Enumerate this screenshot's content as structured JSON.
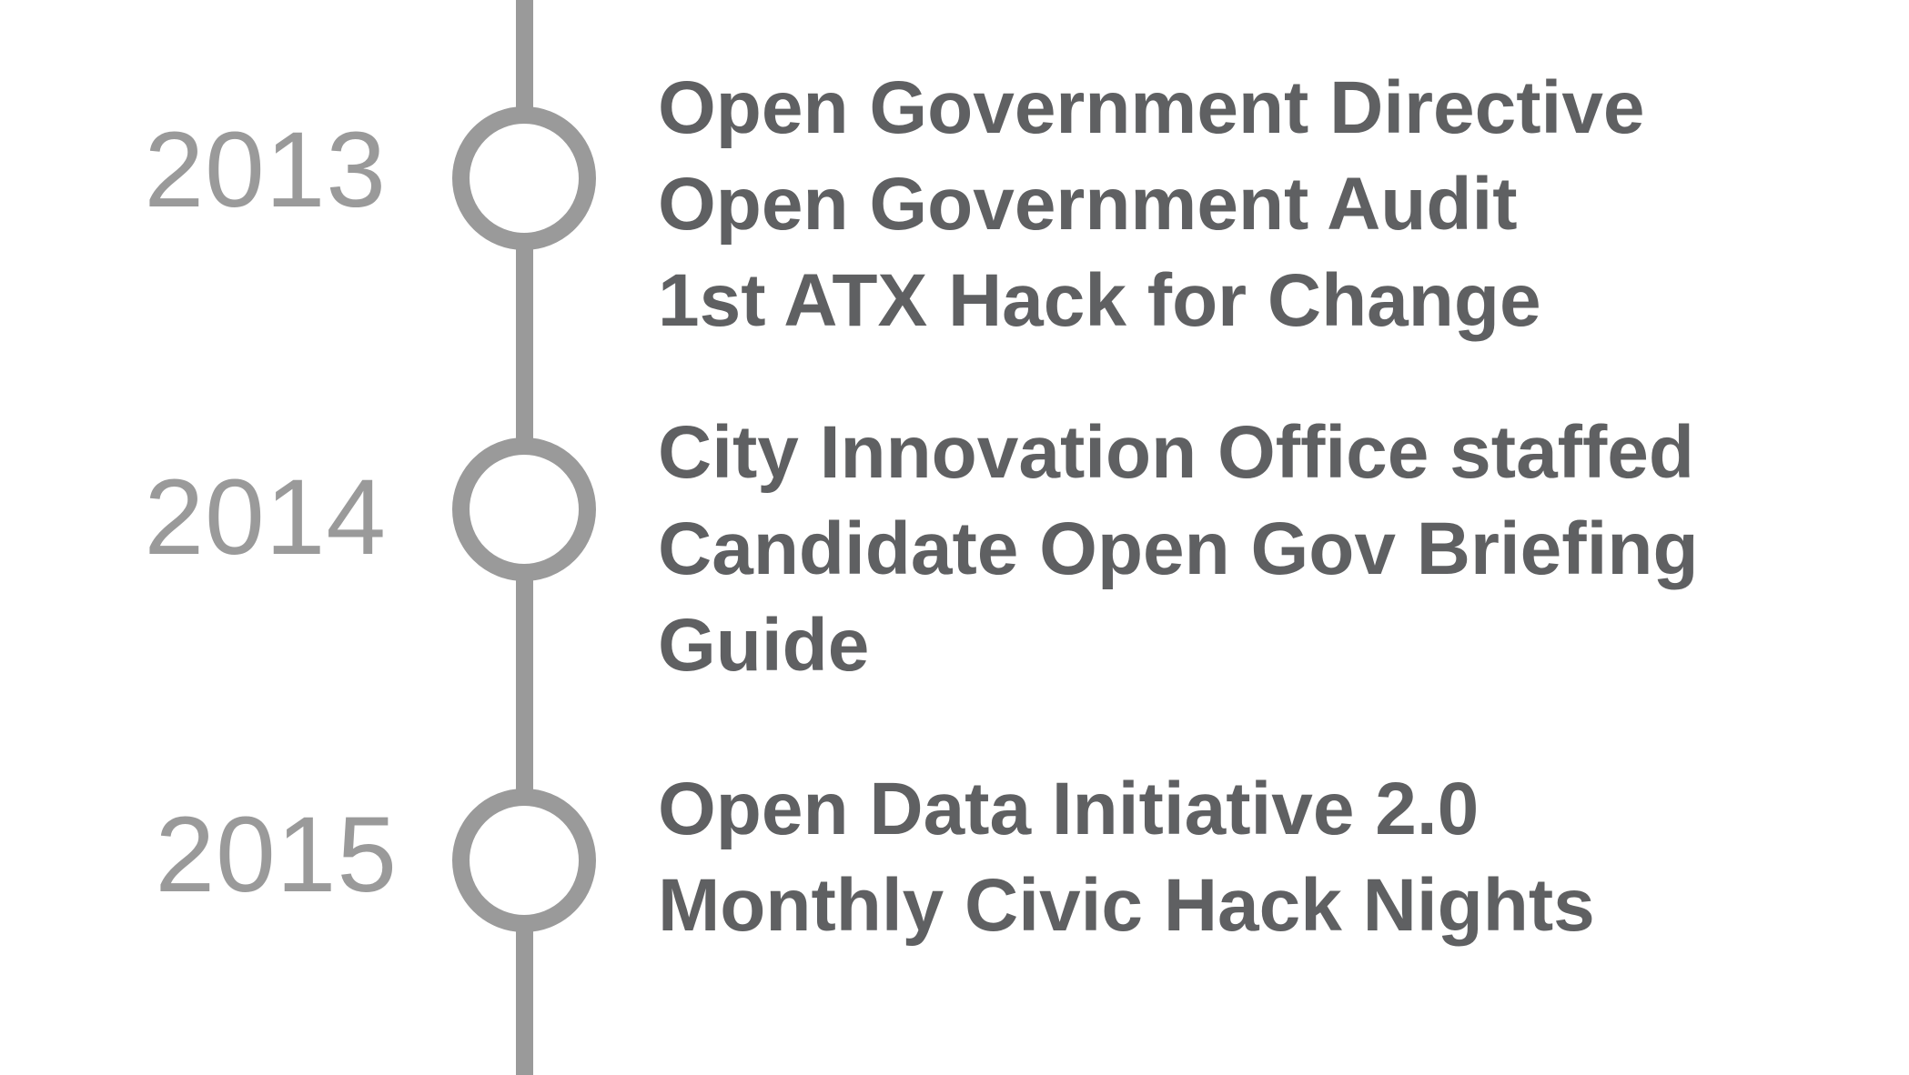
{
  "colors": {
    "background": "#ffffff",
    "line": "#9a9a9a",
    "node_border": "#9a9a9a",
    "year_text": "#9a9a9a",
    "event_text": "#5f6062"
  },
  "timeline": {
    "entries": [
      {
        "year": "2013",
        "events": [
          "Open Government Directive",
          "Open Government Audit",
          "1st ATX Hack for Change"
        ]
      },
      {
        "year": "2014",
        "events": [
          "City Innovation Office staffed",
          "Candidate Open Gov Briefing Guide"
        ]
      },
      {
        "year": "2015",
        "events": [
          "Open Data Initiative 2.0",
          "Monthly Civic Hack Nights"
        ]
      }
    ]
  }
}
